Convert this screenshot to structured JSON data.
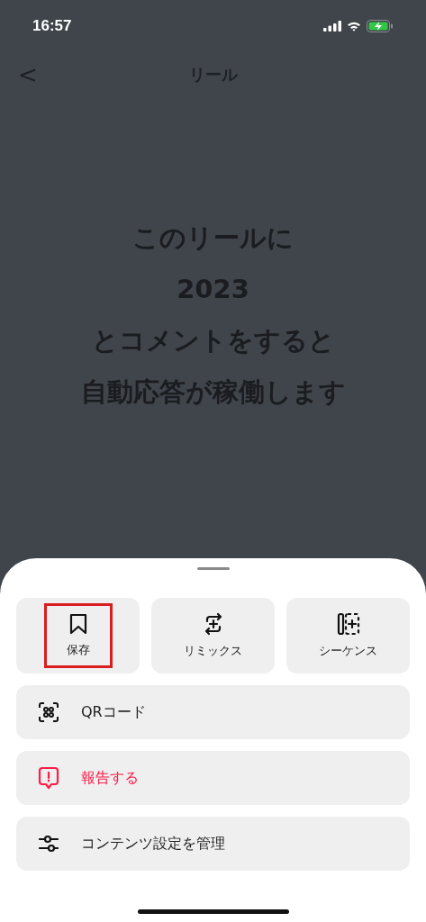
{
  "status_bar": {
    "time": "16:57"
  },
  "nav": {
    "back": "<",
    "title": "リール"
  },
  "reel_text": [
    "このリールに",
    "2023",
    "とコメントをすると",
    "自動応答が稼働します"
  ],
  "sheet": {
    "tiles": [
      {
        "label": "保存",
        "highlighted": true
      },
      {
        "label": "リミックス",
        "highlighted": false
      },
      {
        "label": "シーケンス",
        "highlighted": false
      }
    ],
    "rows": [
      {
        "label": "QRコード",
        "kind": "normal"
      },
      {
        "label": "報告する",
        "kind": "danger"
      },
      {
        "label": "コンテンツ設定を管理",
        "kind": "normal"
      }
    ]
  }
}
